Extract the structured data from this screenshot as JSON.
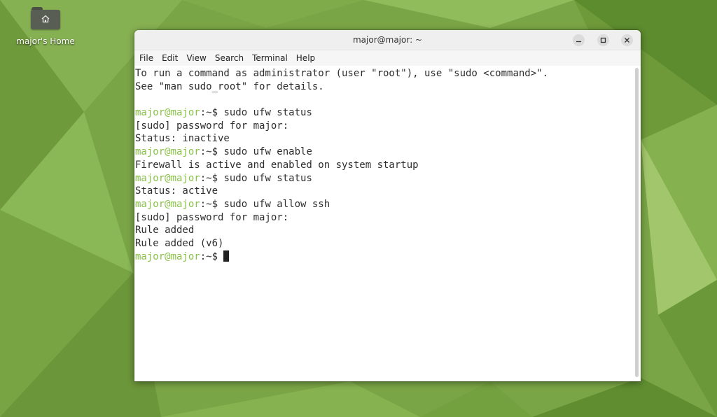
{
  "desktop": {
    "home_label": "major's Home"
  },
  "window": {
    "title": "major@major: ~",
    "menu": [
      "File",
      "Edit",
      "View",
      "Search",
      "Terminal",
      "Help"
    ]
  },
  "terminal": {
    "prompt_user": "major@major",
    "prompt_suffix": ":~$ ",
    "lines": [
      {
        "type": "out",
        "text": "To run a command as administrator (user \"root\"), use \"sudo <command>\"."
      },
      {
        "type": "out",
        "text": "See \"man sudo_root\" for details."
      },
      {
        "type": "out",
        "text": ""
      },
      {
        "type": "cmd",
        "text": "sudo ufw status"
      },
      {
        "type": "out",
        "text": "[sudo] password for major:"
      },
      {
        "type": "out",
        "text": "Status: inactive"
      },
      {
        "type": "cmd",
        "text": "sudo ufw enable"
      },
      {
        "type": "out",
        "text": "Firewall is active and enabled on system startup"
      },
      {
        "type": "cmd",
        "text": "sudo ufw status"
      },
      {
        "type": "out",
        "text": "Status: active"
      },
      {
        "type": "cmd",
        "text": "sudo ufw allow ssh"
      },
      {
        "type": "out",
        "text": "[sudo] password for major:"
      },
      {
        "type": "out",
        "text": "Rule added"
      },
      {
        "type": "out",
        "text": "Rule added (v6)"
      },
      {
        "type": "cmd",
        "text": ""
      }
    ]
  },
  "colors": {
    "prompt": "#8ac249",
    "wallpaper": "#7aa546"
  }
}
